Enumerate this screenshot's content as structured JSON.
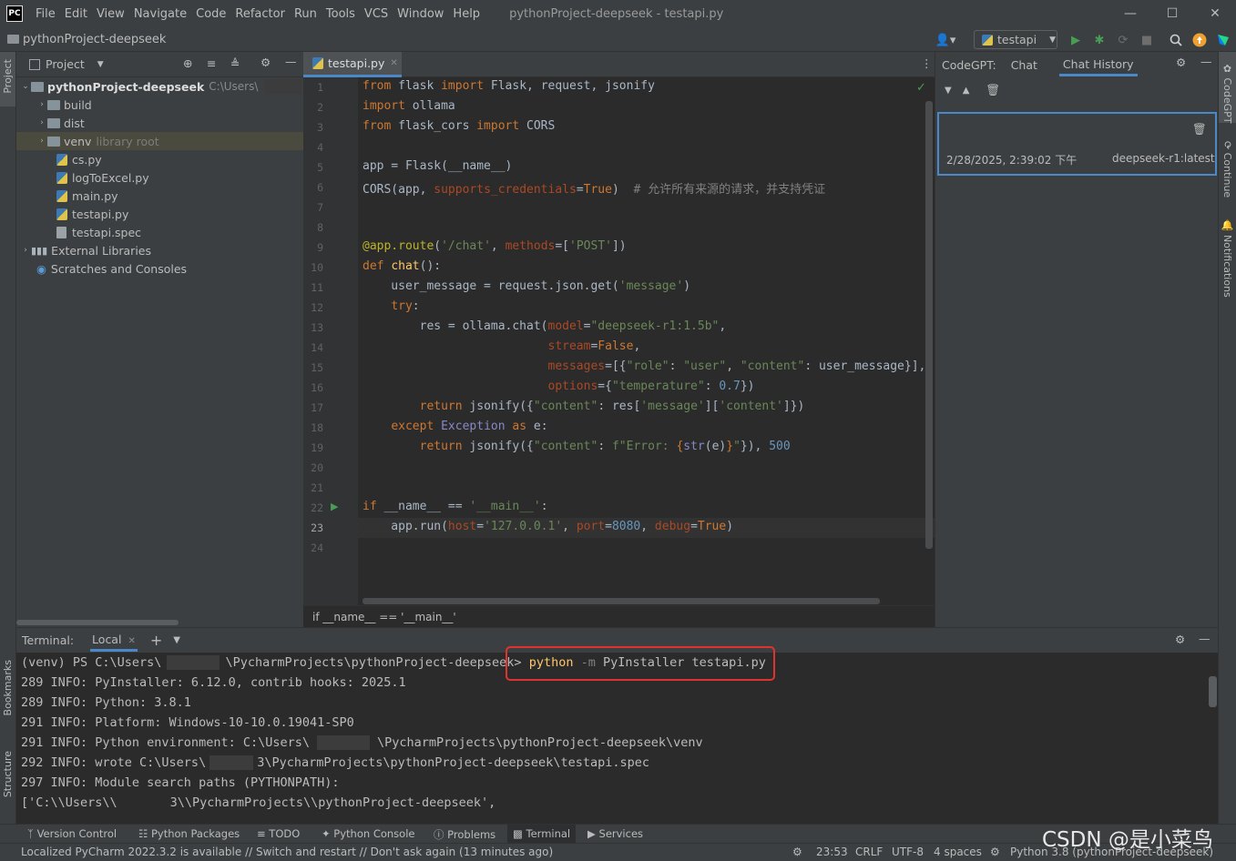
{
  "titlebar": {
    "logo": "PC",
    "menus": [
      "File",
      "Edit",
      "View",
      "Navigate",
      "Code",
      "Refactor",
      "Run",
      "Tools",
      "VCS",
      "Window",
      "Help"
    ],
    "title": "pythonProject-deepseek - testapi.py",
    "minimize_icon": "minimize-icon",
    "maximize_icon": "maximize-icon",
    "close_icon": "close-icon"
  },
  "navbar": {
    "project": "pythonProject-deepseek",
    "run_config": "testapi"
  },
  "left_stripe": {
    "project": "Project",
    "bookmarks": "Bookmarks",
    "structure": "Structure"
  },
  "right_stripe": {
    "codegpt": "CodeGPT",
    "continue": "Continue",
    "notifications": "Notifications"
  },
  "project_panel": {
    "title": "Project",
    "root_name": "pythonProject-deepseek",
    "root_path": "C:\\Users\\",
    "items": [
      {
        "label": "build"
      },
      {
        "label": "dist"
      },
      {
        "label": "venv",
        "note": "library root"
      },
      {
        "label": "cs.py"
      },
      {
        "label": "logToExcel.py"
      },
      {
        "label": "main.py"
      },
      {
        "label": "testapi.py"
      },
      {
        "label": "testapi.spec"
      },
      {
        "label": "External Libraries"
      },
      {
        "label": "Scratches and Consoles"
      }
    ]
  },
  "editor": {
    "tab_label": "testapi.py",
    "breadcrumb": "if __name__ == '__main__'",
    "current_line": 23,
    "line_count": 24
  },
  "codegpt": {
    "title": "CodeGPT:",
    "tab_chat": "Chat",
    "tab_history": "Chat History",
    "history": [
      {
        "date": "2/28/2025, 2:39:02 下午",
        "model": "deepseek-r1:latest"
      }
    ]
  },
  "terminal": {
    "title": "Terminal:",
    "tab": "Local",
    "prompt_prefix": "(venv) PS C:\\Users\\",
    "prompt_suffix": "\\PycharmProjects\\pythonProject-deepseek>",
    "command": "python",
    "command_flag": "-m",
    "command_args": "PyInstaller testapi.py",
    "lines": [
      "289 INFO: PyInstaller: 6.12.0, contrib hooks: 2025.1",
      "289 INFO: Python: 3.8.1",
      "291 INFO: Platform: Windows-10-10.0.19041-SP0"
    ],
    "env_prefix": "291 INFO: Python environment: C:\\Users\\",
    "env_suffix": "\\PycharmProjects\\pythonProject-deepseek\\venv",
    "wrote_prefix": "292 INFO: wrote C:\\Users\\",
    "wrote_suffix": "3\\PycharmProjects\\pythonProject-deepseek\\testapi.spec",
    "module_line": "297 INFO: Module search paths (PYTHONPATH):",
    "paths_prefix": "['C:\\\\Users\\\\",
    "paths_suffix": "3\\\\PycharmProjects\\\\pythonProject-deepseek',"
  },
  "bottom_tools": [
    "Version Control",
    "Python Packages",
    "TODO",
    "Python Console",
    "Problems",
    "Terminal",
    "Services"
  ],
  "status": {
    "message": "Localized PyCharm 2022.3.2 is available // Switch and restart // Don't ask again (13 minutes ago)",
    "position": "23:53",
    "line_sep": "CRLF",
    "encoding": "UTF-8",
    "indent": "4 spaces",
    "interpreter": "Python 3.8 (pythonProject-deepseek)"
  },
  "watermark": "CSDN @是小菜鸟",
  "colors": {
    "accent": "#4a88c7",
    "highlight_box": "#e0332d",
    "run_green": "#499c54"
  }
}
